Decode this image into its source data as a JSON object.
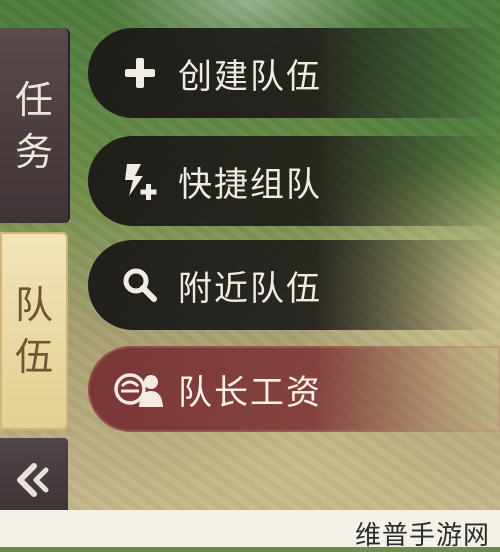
{
  "sidebar": {
    "tabs": [
      {
        "label": "任务",
        "chars": [
          "任",
          "务"
        ],
        "active": false
      },
      {
        "label": "队伍",
        "chars": [
          "队",
          "伍"
        ],
        "active": true
      }
    ],
    "back_icon": "double-chevron-left-icon"
  },
  "menu": {
    "items": [
      {
        "label": "创建队伍",
        "icon": "plus-icon"
      },
      {
        "label": "快捷组队",
        "icon": "lightning-plus-icon"
      },
      {
        "label": "附近队伍",
        "icon": "search-icon"
      },
      {
        "label": "队长工资",
        "icon": "captain-wage-icon"
      }
    ]
  },
  "watermark": "维普手游网",
  "colors": {
    "menu_dark": "#1c1a18",
    "menu_highlight": "#7a3436",
    "tab_active": "#f1e4b7",
    "tab_inactive": "#4a3e40",
    "text_light": "#f0ece4"
  }
}
